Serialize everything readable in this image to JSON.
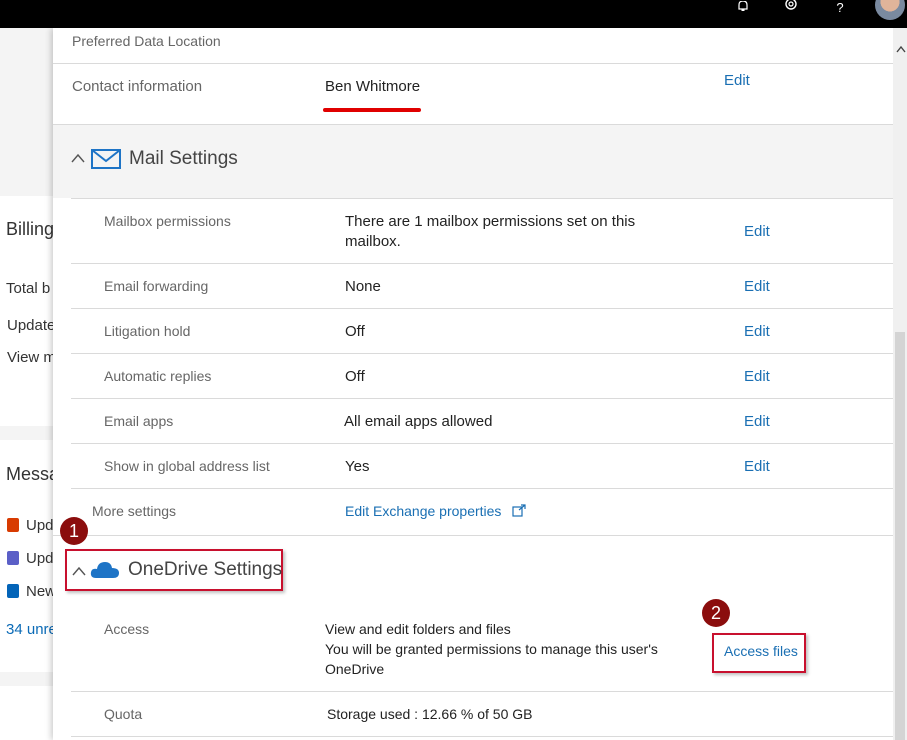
{
  "topbar": {
    "icons": [
      "bell-icon",
      "gear-icon",
      "help-icon",
      "avatar"
    ],
    "help_glyph": "?"
  },
  "background": {
    "billing_title": "Billing",
    "total_text": "Total b",
    "update_text": "Update",
    "view_text": "View m",
    "messages_title": "Messa",
    "msg1": "Upd",
    "msg2": "Upd",
    "msg3": "New",
    "unread_link": "34 unre"
  },
  "panel": {
    "preferred_data_location": {
      "label": "Preferred Data Location"
    },
    "contact": {
      "label": "Contact information",
      "name": "Ben Whitmore",
      "edit": "Edit"
    },
    "mail_settings": {
      "title": "Mail Settings",
      "rows": [
        {
          "label": "Mailbox permissions",
          "value_line1": "There are 1 mailbox permissions set on this",
          "value_line2": "mailbox.",
          "action": "Edit"
        },
        {
          "label": "Email forwarding",
          "value": "None",
          "action": "Edit"
        },
        {
          "label": "Litigation hold",
          "value": "Off",
          "action": "Edit"
        },
        {
          "label": "Automatic replies",
          "value": "Off",
          "action": "Edit"
        },
        {
          "label": "Email apps",
          "value": "All email apps allowed",
          "action": "Edit"
        },
        {
          "label": "Show in global address list",
          "value": "Yes",
          "action": "Edit"
        }
      ],
      "more_settings": {
        "label": "More settings",
        "link": "Edit Exchange properties"
      }
    },
    "onedrive_settings": {
      "title": "OneDrive Settings",
      "access": {
        "label": "Access",
        "line1": "View and edit folders and files",
        "line2": "You will be granted permissions to manage this user's",
        "line3": "OneDrive",
        "action": "Access files"
      },
      "quota": {
        "label": "Quota",
        "value": "Storage used : 12.66 % of 50 GB"
      }
    }
  },
  "annotations": {
    "badge1": "1",
    "badge2": "2"
  },
  "colors": {
    "link": "#1a6fb3",
    "annotation_red": "#c8102e",
    "badge": "#8b0d0d",
    "accent_blue": "#1e74c6"
  }
}
